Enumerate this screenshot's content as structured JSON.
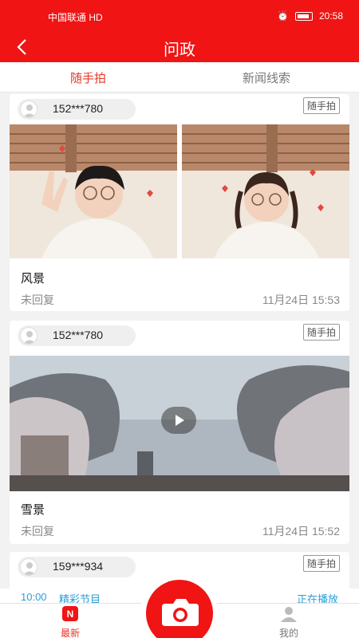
{
  "status_bar": {
    "carrier": "中国联通 HD",
    "time": "20:58"
  },
  "header": {
    "title": "问政"
  },
  "tabs": [
    {
      "label": "随手拍"
    },
    {
      "label": "新闻线索"
    }
  ],
  "posts": [
    {
      "user": "152***780",
      "tag": "随手拍",
      "title": "风景",
      "status": "未回复",
      "time": "11月24日 15:53"
    },
    {
      "user": "152***780",
      "tag": "随手拍",
      "title": "雪景",
      "status": "未回复",
      "time": "11月24日 15:52"
    },
    {
      "user": "159***934",
      "tag": "随手拍"
    }
  ],
  "ticker": {
    "time": "10:00",
    "program": "精彩节目",
    "status": "正在播放"
  },
  "bottom_nav": {
    "latest": "最新",
    "latest_badge": "N",
    "mine": "我的"
  },
  "colors": {
    "brand": "#f01414",
    "accent": "#e83828",
    "link": "#2a9fd8"
  },
  "icons": [
    "back-icon",
    "camera-icon",
    "play-icon",
    "avatar-icon",
    "user-icon",
    "news-app-icon"
  ]
}
